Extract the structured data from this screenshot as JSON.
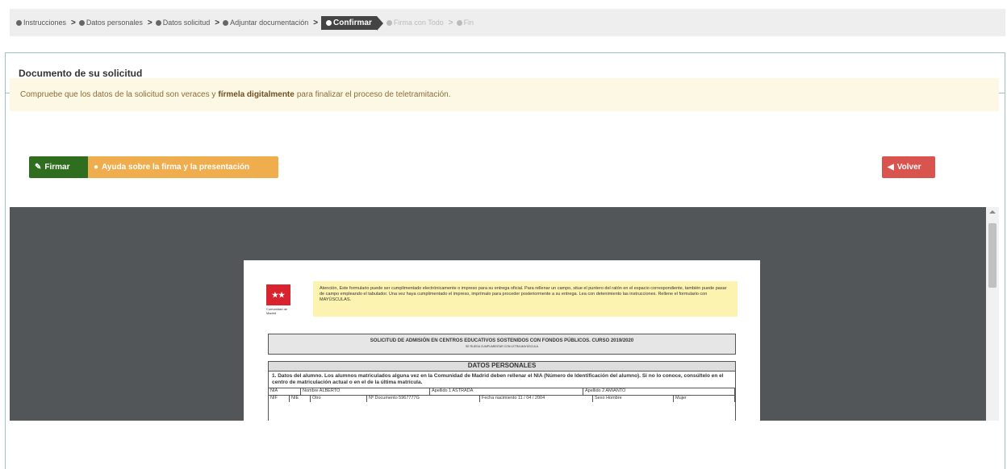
{
  "steps": [
    {
      "label": "Instrucciones",
      "state": "done"
    },
    {
      "label": "Datos personales",
      "state": "done"
    },
    {
      "label": "Datos solicitud",
      "state": "done"
    },
    {
      "label": "Adjuntar documentación",
      "state": "done"
    },
    {
      "label": "Confirmar",
      "state": "active"
    },
    {
      "label": "Firma con Todo",
      "state": "future"
    },
    {
      "label": "Fin",
      "state": "future"
    }
  ],
  "panel": {
    "title": "Documento de su solicitud"
  },
  "alert": {
    "text_before": "Compruebe que los datos de la solicitud son veraces y",
    "text_bold": "fírmela digitalmente",
    "text_after": "para finalizar el proceso de teletramitación."
  },
  "buttons": {
    "sign": "Firmar",
    "help": "Ayuda sobre la firma y la presentación",
    "back": "Volver"
  },
  "document": {
    "logo_text": "Comunidad de Madrid",
    "note": "Atención, Este formulario puede ser cumplimentado electrónicamente o impreso para su entrega oficial. Para rellenar un campo, situe el puntero del ratón en el espacio correspondiente, también puede pasar de campo empleando el tabulador. Una vez haya cumplimentado el impreso, imprímalo para proceder posteriormente a su entrega. Lea con detenimiento las instrucciones. Rellene el formulario con MAYÚSCULAS.",
    "form_title": "SOLICITUD DE ADMISIÓN EN CENTROS EDUCATIVOS SOSTENIDOS CON FONDOS PÚBLICOS. CURSO 2019/2020",
    "form_subtitle": "SE RUEGA CUMPLIMENTAR CON LETRA MAYÚSCULA",
    "section_header": "DATOS PERSONALES",
    "section_body": "1. Datos del alumno. Los alumnos matriculados alguna vez en la Comunidad de Madrid deben rellenar el NIA (Número de Identificación del alumno). Si no lo conoce, consúltelo en el centro de matriculación actual o en el de la última matrícula.",
    "row1": [
      "NIA",
      "Nombre  ALBERTO",
      "Apellido 1  ASTRADA",
      "Apellido 2  AMIANTO"
    ],
    "row2": [
      "NIF",
      "NIE",
      "Otro",
      "Nº Documento  5967777G",
      "Fecha nacimiento  11 / 04 / 2004",
      "Sexo  Hombre",
      "Mujer"
    ]
  }
}
